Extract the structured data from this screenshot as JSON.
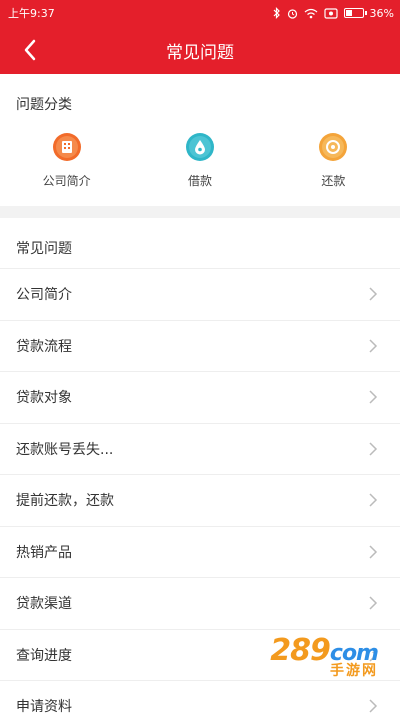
{
  "status_bar": {
    "time": "上午9:37",
    "battery": "36%"
  },
  "header": {
    "title": "常见问题"
  },
  "categories": {
    "heading": "问题分类",
    "items": [
      {
        "label": "公司简介",
        "icon": "building-icon",
        "color": "#f26b2a"
      },
      {
        "label": "借款",
        "icon": "money-drop-icon",
        "color": "#2fb6c8"
      },
      {
        "label": "还款",
        "icon": "coin-icon",
        "color": "#f4a43a"
      }
    ]
  },
  "faq": {
    "heading": "常见问题",
    "items": [
      {
        "label": "公司简介"
      },
      {
        "label": "贷款流程"
      },
      {
        "label": "贷款对象"
      },
      {
        "label": "还款账号丢失..."
      },
      {
        "label": "提前还款，还款"
      },
      {
        "label": "热销产品"
      },
      {
        "label": "贷款渠道"
      },
      {
        "label": "查询进度"
      },
      {
        "label": "申请资料"
      }
    ]
  },
  "watermark": {
    "top_orange": "289",
    "top_blue": "com",
    "bottom": "手游网"
  },
  "colors": {
    "brand_red": "#e41f2b",
    "divider": "#eeeeee",
    "section_gray": "#f2f2f2",
    "chevron": "#bbbbbb"
  }
}
